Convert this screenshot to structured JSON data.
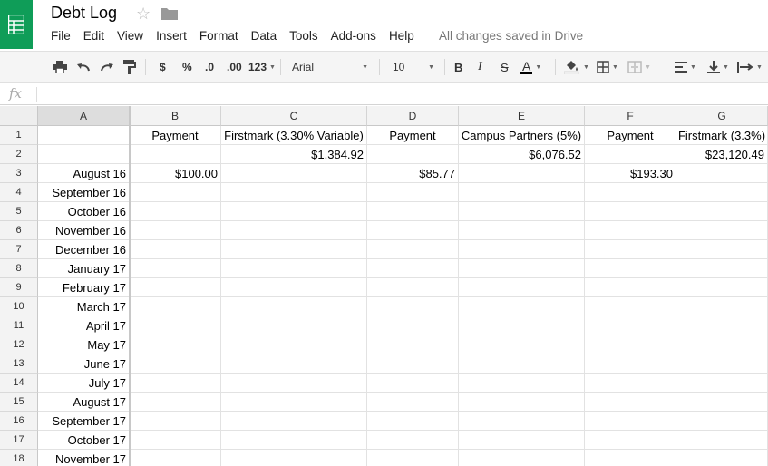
{
  "doc": {
    "title": "Debt Log"
  },
  "menu": [
    "File",
    "Edit",
    "View",
    "Insert",
    "Format",
    "Data",
    "Tools",
    "Add-ons",
    "Help"
  ],
  "save_status": "All changes saved in Drive",
  "toolbar": {
    "currency": "$",
    "percent": "%",
    "dec_decrease": ".0",
    "dec_increase": ".00",
    "more_formats": "123",
    "font": "Arial",
    "font_size": "10",
    "bold": "B",
    "italic": "I",
    "strike": "S",
    "text_color": "A"
  },
  "formula_bar": {
    "icon": "fx"
  },
  "columns": [
    "A",
    "B",
    "C",
    "D",
    "E",
    "F",
    "G"
  ],
  "rows": [
    [
      "",
      "Payment",
      "Firstmark (3.30% Variable)",
      "Payment",
      "Campus Partners (5%)",
      "Payment",
      "Firstmark (3.3%)"
    ],
    [
      "",
      "",
      "$1,384.92",
      "",
      "$6,076.52",
      "",
      "$23,120.49"
    ],
    [
      "August 16",
      "$100.00",
      "",
      "$85.77",
      "",
      "$193.30",
      ""
    ],
    [
      "September 16",
      "",
      "",
      "",
      "",
      "",
      ""
    ],
    [
      "October 16",
      "",
      "",
      "",
      "",
      "",
      ""
    ],
    [
      "November 16",
      "",
      "",
      "",
      "",
      "",
      ""
    ],
    [
      "December 16",
      "",
      "",
      "",
      "",
      "",
      ""
    ],
    [
      "January 17",
      "",
      "",
      "",
      "",
      "",
      ""
    ],
    [
      "February 17",
      "",
      "",
      "",
      "",
      "",
      ""
    ],
    [
      "March 17",
      "",
      "",
      "",
      "",
      "",
      ""
    ],
    [
      "April 17",
      "",
      "",
      "",
      "",
      "",
      ""
    ],
    [
      "May 17",
      "",
      "",
      "",
      "",
      "",
      ""
    ],
    [
      "June 17",
      "",
      "",
      "",
      "",
      "",
      ""
    ],
    [
      "July 17",
      "",
      "",
      "",
      "",
      "",
      ""
    ],
    [
      "August 17",
      "",
      "",
      "",
      "",
      "",
      ""
    ],
    [
      "September 17",
      "",
      "",
      "",
      "",
      "",
      ""
    ],
    [
      "October 17",
      "",
      "",
      "",
      "",
      "",
      ""
    ],
    [
      "November 17",
      "",
      "",
      "",
      "",
      "",
      ""
    ]
  ],
  "colors": {
    "brand": "#0f9d58",
    "text_color_bar": "#000000"
  }
}
